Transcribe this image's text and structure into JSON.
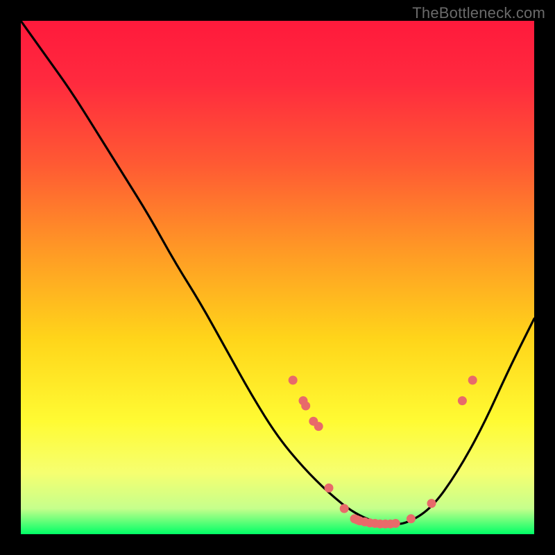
{
  "watermark": "TheBottleneck.com",
  "chart_data": {
    "type": "line",
    "title": "",
    "xlabel": "",
    "ylabel": "",
    "xlim": [
      0,
      100
    ],
    "ylim": [
      0,
      100
    ],
    "grid": false,
    "legend": false,
    "gradient_stops": [
      {
        "offset": 0.0,
        "color": "#ff1a3c"
      },
      {
        "offset": 0.12,
        "color": "#ff2a3e"
      },
      {
        "offset": 0.28,
        "color": "#ff5a33"
      },
      {
        "offset": 0.45,
        "color": "#ff9a25"
      },
      {
        "offset": 0.62,
        "color": "#ffd51a"
      },
      {
        "offset": 0.78,
        "color": "#fffb33"
      },
      {
        "offset": 0.88,
        "color": "#f6ff70"
      },
      {
        "offset": 0.95,
        "color": "#c6ff8c"
      },
      {
        "offset": 1.0,
        "color": "#00ff66"
      }
    ],
    "series": [
      {
        "name": "bottleneck-curve",
        "x": [
          0,
          5,
          10,
          15,
          20,
          25,
          30,
          35,
          40,
          45,
          50,
          55,
          60,
          65,
          70,
          72,
          75,
          80,
          85,
          90,
          95,
          100
        ],
        "y": [
          100,
          93,
          86,
          78,
          70,
          62,
          53,
          45,
          36,
          27,
          19,
          13,
          8,
          4,
          2,
          2,
          2,
          5,
          12,
          21,
          32,
          42
        ]
      }
    ],
    "markers": {
      "name": "highlighted-points",
      "color": "#e86a6a",
      "points": [
        {
          "x": 53,
          "y": 30
        },
        {
          "x": 55,
          "y": 26
        },
        {
          "x": 55.5,
          "y": 25
        },
        {
          "x": 57,
          "y": 22
        },
        {
          "x": 58,
          "y": 21
        },
        {
          "x": 60,
          "y": 9
        },
        {
          "x": 63,
          "y": 5
        },
        {
          "x": 65,
          "y": 3
        },
        {
          "x": 65.5,
          "y": 2.8
        },
        {
          "x": 66,
          "y": 2.6
        },
        {
          "x": 67,
          "y": 2.4
        },
        {
          "x": 68,
          "y": 2.2
        },
        {
          "x": 69,
          "y": 2.1
        },
        {
          "x": 70,
          "y": 2.0
        },
        {
          "x": 71,
          "y": 2.0
        },
        {
          "x": 72,
          "y": 2.0
        },
        {
          "x": 73,
          "y": 2.1
        },
        {
          "x": 76,
          "y": 3
        },
        {
          "x": 80,
          "y": 6
        },
        {
          "x": 86,
          "y": 26
        },
        {
          "x": 88,
          "y": 30
        }
      ]
    }
  }
}
